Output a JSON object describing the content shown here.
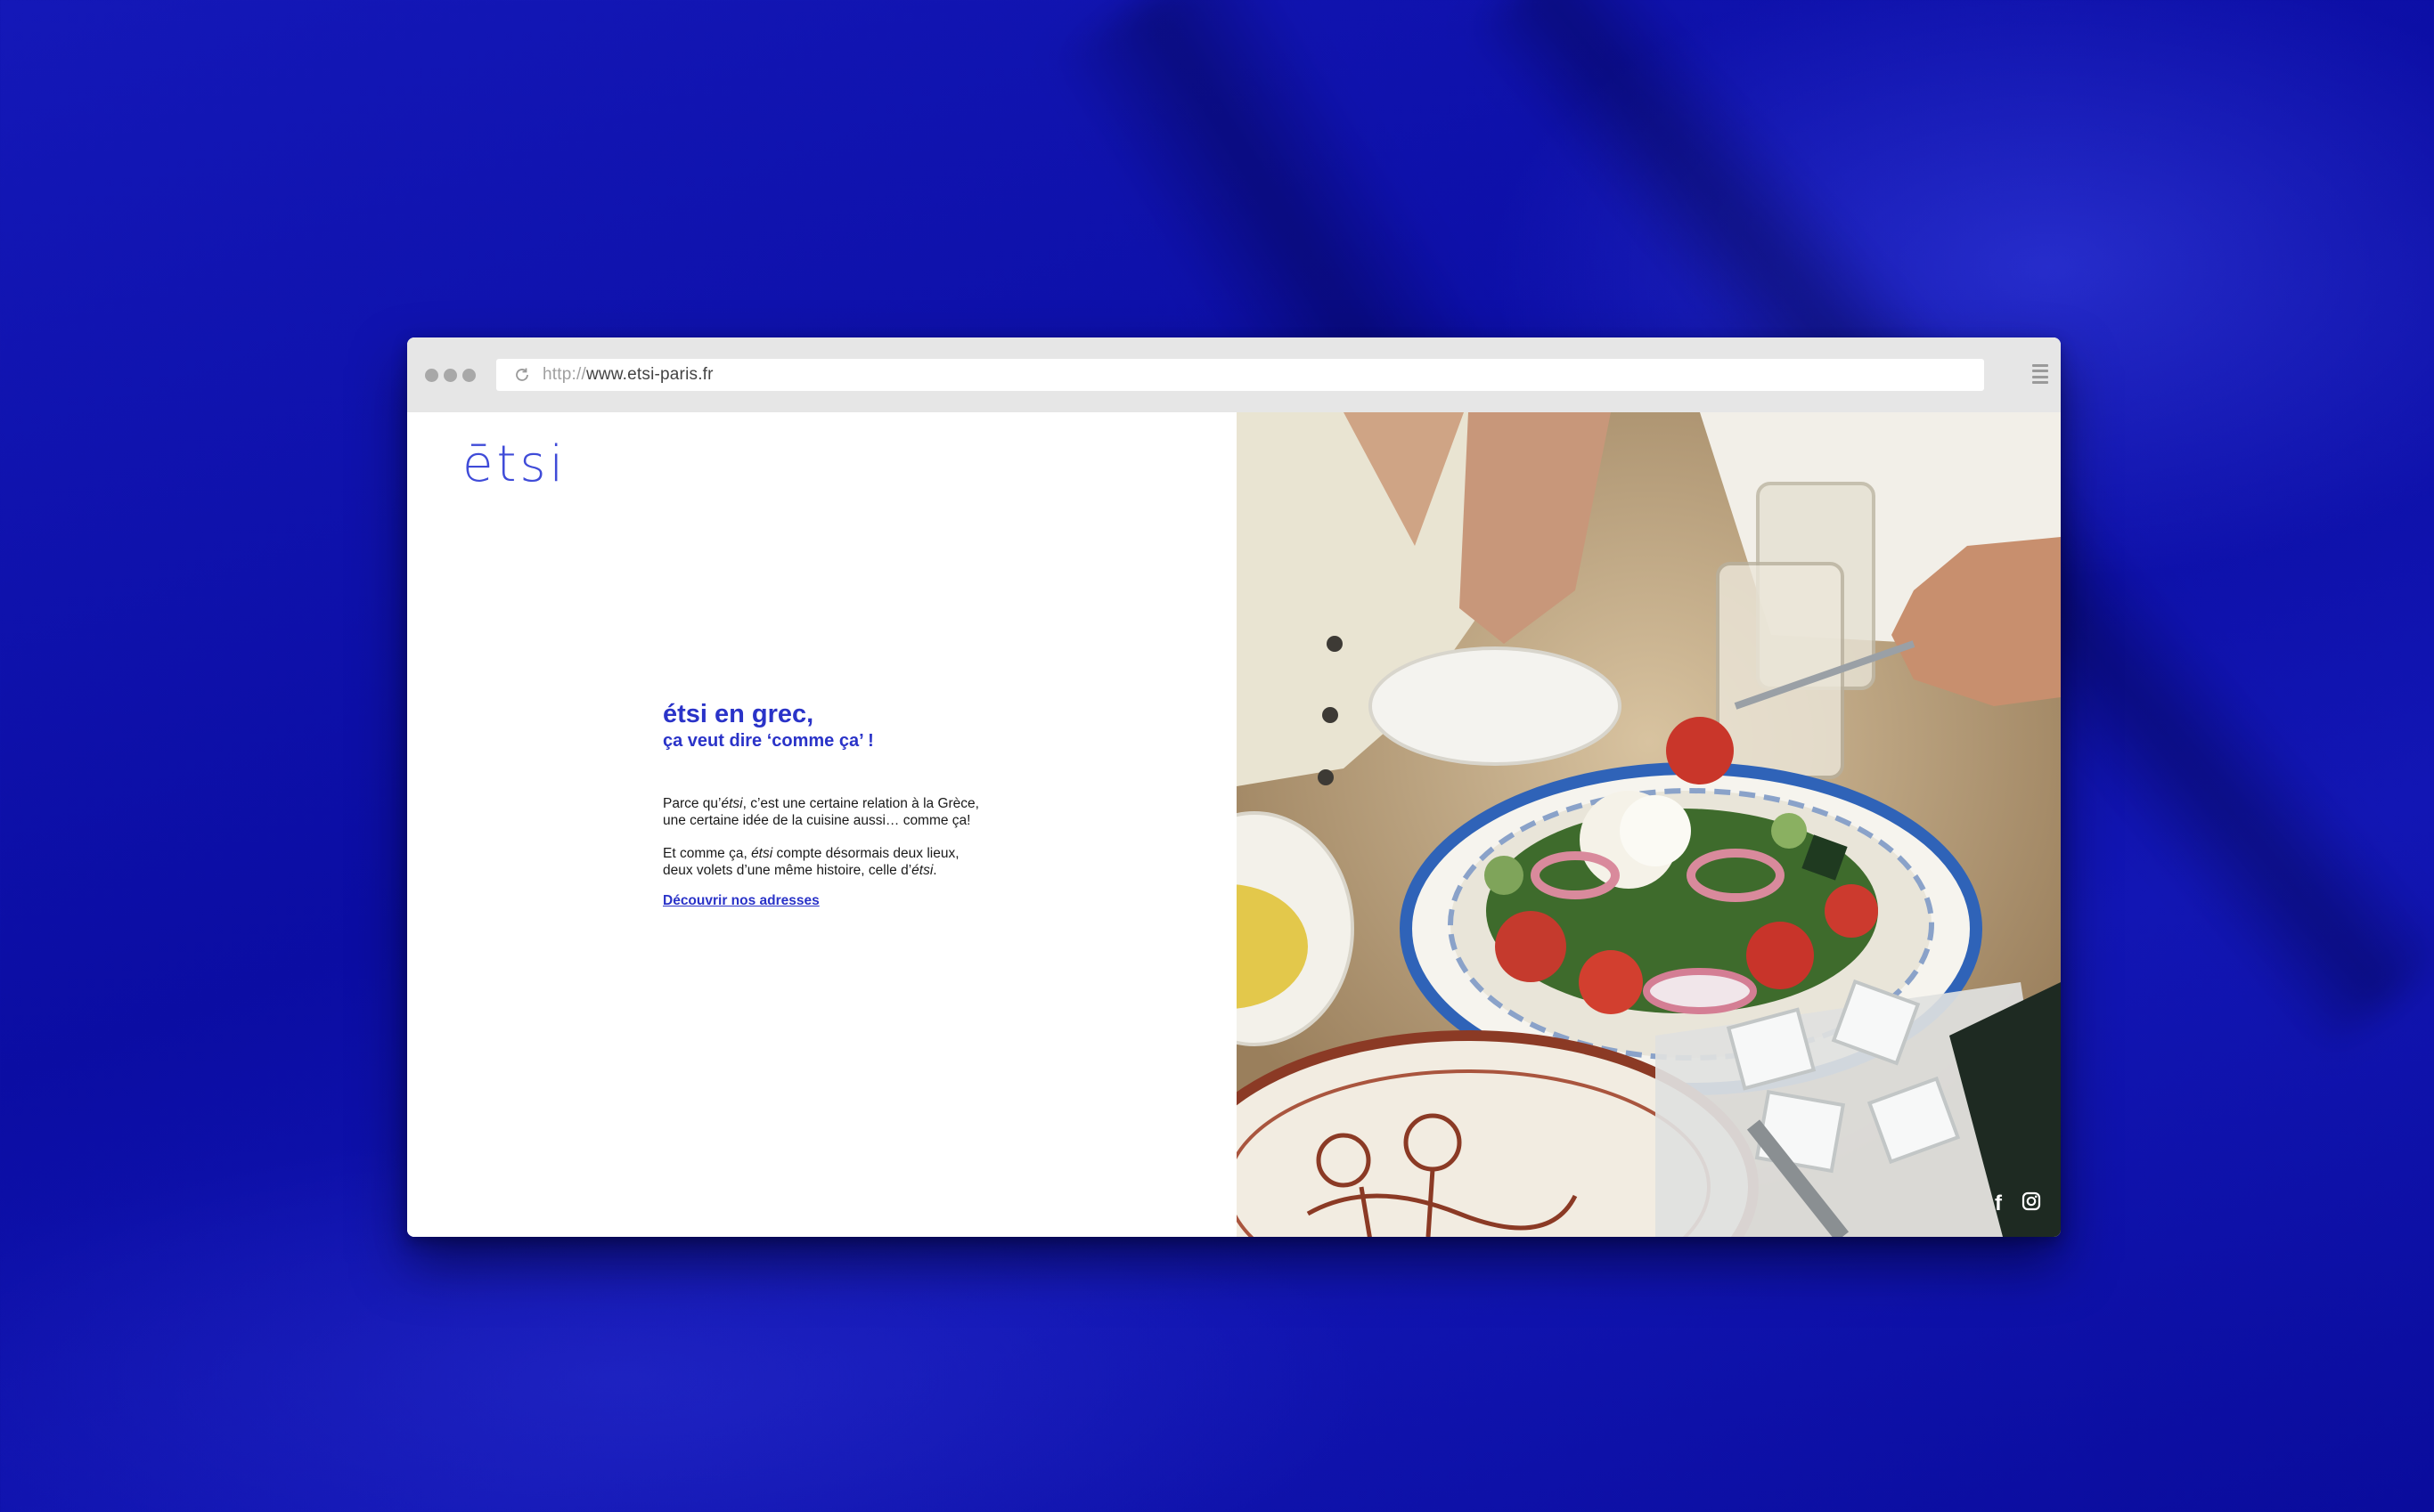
{
  "browser": {
    "url_protocol": "http://",
    "url_host": "www.etsi-paris.fr"
  },
  "site": {
    "logo": "ētsi",
    "headline": "étsi en grec,",
    "subheadline": "ça veut dire ‘comme ça’ !",
    "paragraph1": {
      "before": "Parce qu’",
      "em": "étsi",
      "after": ", c’est une certaine relation à la Grèce, une certaine idée de la cuisine aussi… comme ça!"
    },
    "paragraph2": {
      "before": "Et comme ça, ",
      "em1": "étsi",
      "middle": " compte désormais deux lieux, deux volets d’une même histoire, celle d’",
      "em2": "étsi",
      "after": "."
    },
    "cta_link": "Découvrir nos adresses",
    "social_icons": [
      "facebook-icon",
      "instagram-icon"
    ]
  },
  "colors": {
    "background": "#0f12ad",
    "brand_blue": "#2a33c8"
  }
}
